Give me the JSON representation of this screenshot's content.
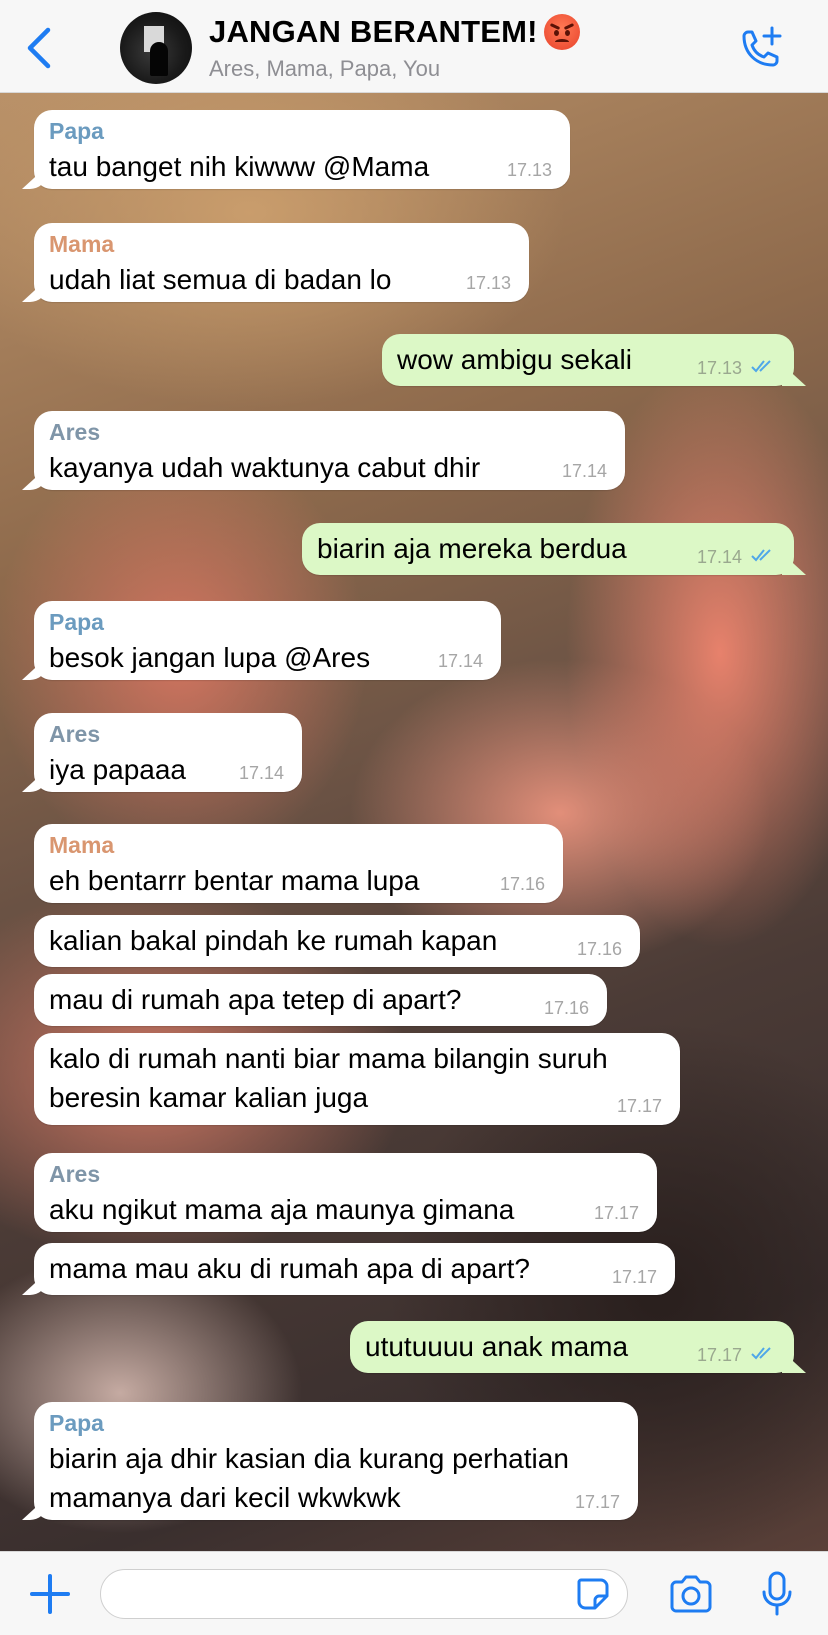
{
  "header": {
    "title": "JANGAN BERANTEM!",
    "title_emoji": "angry-face",
    "members": "Ares, Mama, Papa, You",
    "back_icon": "chevron-left-icon",
    "call_icon": "phone-add-icon"
  },
  "colors": {
    "accent": "#1e7cf2",
    "outgoing_bubble": "#dcf8c6",
    "incoming_bubble": "#ffffff",
    "sender_papa": "#6b9bbf",
    "sender_mama": "#d99670",
    "sender_ares": "#7f95a8",
    "read_ticks": "#4fa7e8"
  },
  "messages": [
    {
      "sender": "Papa",
      "text": "tau banget nih kiwww @Mama",
      "time": "17.13",
      "direction": "in"
    },
    {
      "sender": "Mama",
      "text": "udah liat semua di badan lo",
      "time": "17.13",
      "direction": "in"
    },
    {
      "sender": "",
      "text": "wow ambigu sekali",
      "time": "17.13",
      "direction": "out",
      "read": true
    },
    {
      "sender": "Ares",
      "text": "kayanya udah waktunya cabut dhir",
      "time": "17.14",
      "direction": "in"
    },
    {
      "sender": "",
      "text": "biarin aja mereka berdua",
      "time": "17.14",
      "direction": "out",
      "read": true
    },
    {
      "sender": "Papa",
      "text": "besok jangan lupa @Ares",
      "time": "17.14",
      "direction": "in"
    },
    {
      "sender": "Ares",
      "text": "iya papaaa",
      "time": "17.14",
      "direction": "in"
    },
    {
      "sender": "Mama",
      "text": "eh bentarrr bentar mama lupa",
      "time": "17.16",
      "direction": "in"
    },
    {
      "sender": "",
      "text": "kalian bakal pindah ke rumah kapan",
      "time": "17.16",
      "direction": "in"
    },
    {
      "sender": "",
      "text": "mau di rumah apa tetep di apart?",
      "time": "17.16",
      "direction": "in"
    },
    {
      "sender": "",
      "text": "kalo di rumah nanti biar mama bilangin suruh\nberesin kamar kalian juga",
      "time": "17.17",
      "direction": "in"
    },
    {
      "sender": "Ares",
      "text": "aku ngikut mama aja maunya gimana",
      "time": "17.17",
      "direction": "in"
    },
    {
      "sender": "",
      "text": "mama mau aku di rumah apa di apart?",
      "time": "17.17",
      "direction": "in"
    },
    {
      "sender": "",
      "text": "ututuuuu anak mama",
      "time": "17.17",
      "direction": "out",
      "read": true
    },
    {
      "sender": "Papa",
      "text": "biarin aja dhir kasian dia kurang perhatian\nmamanya dari kecil wkwkwk",
      "time": "17.17",
      "direction": "in"
    }
  ],
  "composer": {
    "placeholder": "",
    "plus_icon": "plus-icon",
    "sticker_icon": "sticker-icon",
    "camera_icon": "camera-icon",
    "mic_icon": "microphone-icon"
  }
}
